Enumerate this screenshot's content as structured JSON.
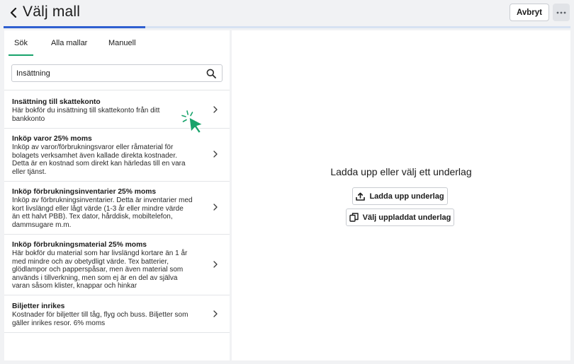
{
  "header": {
    "title": "Välj mall",
    "cancel_label": "Avbryt",
    "more_icon": "ellipsis-icon"
  },
  "progress": {
    "fraction": 0.25
  },
  "colors": {
    "accent": "#18a36b",
    "progress": "#2f5fd0"
  },
  "tabs": [
    {
      "label": "Sök",
      "active": true
    },
    {
      "label": "Alla mallar",
      "active": false
    },
    {
      "label": "Manuell",
      "active": false
    }
  ],
  "search": {
    "value": "Insättning",
    "placeholder": ""
  },
  "templates": [
    {
      "title": "Insättning till skattekonto",
      "desc": [
        "Här bokför du insättning till skattekonto från ditt",
        "bankkonto"
      ]
    },
    {
      "title": "Inköp varor 25% moms",
      "desc": [
        "Inköp av varor/förbrukningsvaror eller råmaterial för",
        "bolagets verksamhet även kallade direkta kostnader.",
        "Detta är en kostnad som direkt kan härledas till en vara",
        "eller tjänst."
      ]
    },
    {
      "title": "Inköp förbrukningsinventarier 25% moms",
      "desc": [
        "Inköp av förbrukningsinventarier. Detta är inventarier med",
        "kort livslängd eller lågt värde (1-3 år eller mindre värde",
        "än ett halvt PBB). Tex dator, hårddisk, mobiltelefon,",
        "dammsugare m.m."
      ]
    },
    {
      "title": "Inköp förbrukningsmaterial 25% moms",
      "desc": [
        "Här bokför du material som har livslängd kortare än 1 år",
        "med mindre och av obetydligt värde. Tex batterier,",
        "glödlampor och papperspåsar, men även material som",
        "används i tillverkning, men som ej är en del av själva",
        "varan såsom klister, knappar och hinkar"
      ]
    },
    {
      "title": "Biljetter inrikes",
      "desc": [
        "Kostnader för biljetter till tåg, flyg och buss. Biljetter som",
        "gäller inrikes resor. 6% moms"
      ]
    }
  ],
  "upload": {
    "title": "Ladda upp eller välj ett underlag",
    "upload_label": "Ladda upp underlag",
    "choose_label": "Välj uppladdat underlag"
  }
}
